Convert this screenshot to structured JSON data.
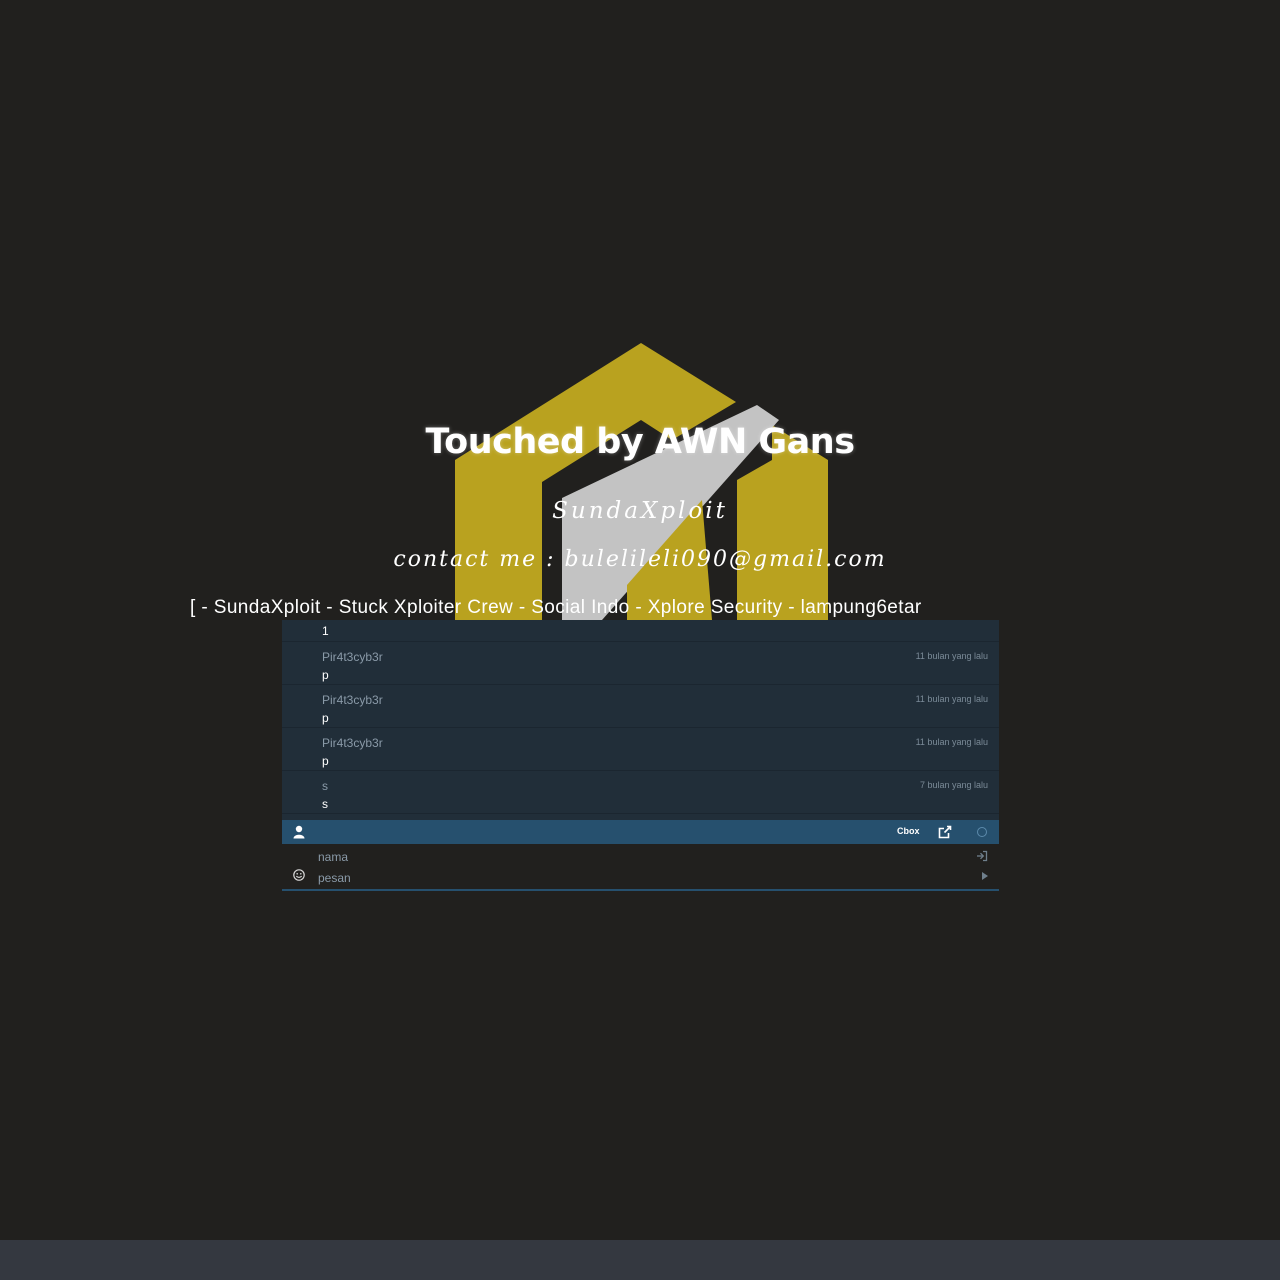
{
  "page": {
    "title": "Touched by AWN Gans",
    "subtitle": "SundaXploit",
    "contact": "contact me : bulelileli090@gmail.com",
    "teams": "[ - SundaXploit - Stuck Xploiter Crew - Social Indo - Xplore Security - lampung6etar"
  },
  "colors": {
    "background": "#21201e",
    "logo_gold": "#b9a21f",
    "logo_gray": "#c3c3c3",
    "chat_bg": "#212e39",
    "chat_bar": "#26506e",
    "footer": "#343840"
  },
  "cbox": {
    "messages": [
      {
        "text": "1"
      },
      {
        "name": "Pir4t3cyb3r",
        "time": "11 bulan yang lalu",
        "text": "p"
      },
      {
        "name": "Pir4t3cyb3r",
        "time": "11 bulan yang lalu",
        "text": "p"
      },
      {
        "name": "Pir4t3cyb3r",
        "time": "11 bulan yang lalu",
        "text": "p"
      },
      {
        "name": "s",
        "time": "7 bulan yang lalu",
        "text": "s"
      }
    ],
    "bar": {
      "label": "Cbox",
      "icons": [
        "user-icon",
        "external-link-icon",
        "status-circle-icon"
      ]
    },
    "form": {
      "name_placeholder": "nama",
      "message_placeholder": "pesan",
      "icons": [
        "smiley-icon",
        "sign-in-icon",
        "send-icon"
      ]
    }
  }
}
